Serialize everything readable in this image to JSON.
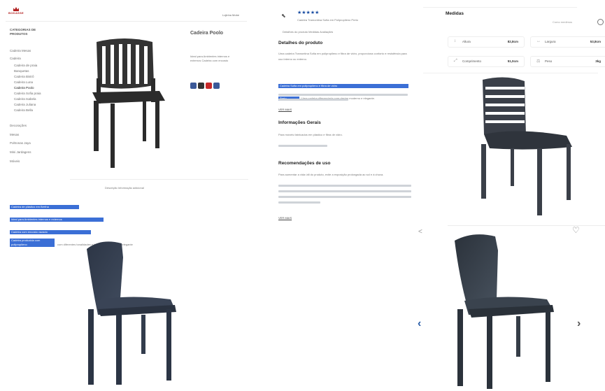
{
  "store": {
    "logo_text": "BOKASSE"
  },
  "left_panel": {
    "top_link": "Lojinha Mobe",
    "sidebar_title": "CATEGORIAS DE PRODUTOS",
    "sidebar_items": [
      "Cadeira Mesas",
      "Cadeira",
      "Cadeira de praia",
      "Banquetas",
      "Cadeira Bistrô",
      "Cadeira Luna",
      "Cadeira Poolo",
      "Cadeira Sofia praia",
      "Cadeira Isabela",
      "Cadeira Juliana",
      "Cadeira Bella",
      "Decorações",
      "Mesas",
      "Poltronas Jaya",
      "Mini Jardagens",
      "Móveis"
    ],
    "product_title": "Cadeira Poolo",
    "short_desc": "Ideal para Ambientes internos e externos Cadeira com encosto",
    "thumb_caption": "Descrição   Informação adicional",
    "highlighted_lines": [
      "Cadeira de plástico em Bertha",
      "Ideal para Ambientes internos e externos",
      "Cadeira com encosto vazado",
      "Cadeira produzida com polipropileno"
    ],
    "highlight_tail": "com diferentes tonalidades e linhas de acabamento elegante"
  },
  "middle_panel": {
    "stars": "★★★★★",
    "breadcrumb": "Cadeira Tramontina Sofia em Polipropileno Preto",
    "tabs": "Detalhes do produto   Medidas   Avaliações",
    "section_details": "Detalhes do produto",
    "details_text": "Uma cadeira Tramontina Sofia em polipropileno e fibra de vidro, proporciona conforto e resistência para uso interno ou externo.",
    "details_highlight_1": "Cadeira Sofia em polipropileno e fibra de vidro",
    "details_highlight_2": "Preto",
    "details_tail": "Uma cadeira diferenciada com design moderno e elegante.",
    "ver_mais_1": "VER MAIS",
    "section_info": "Informações Gerais",
    "info_text": "Para móveis fabricados em plástico e fibra de vidro.",
    "section_recs": "Recomendações de uso",
    "recs_text": "Para aumentar a vida útil do produto, evite a exposição prolongada ao sol e à chuva.",
    "ver_mais_2": "VER MAIS"
  },
  "right_panel": {
    "title": "Medidas",
    "search_placeholder": "Como medimos",
    "measures": [
      {
        "icon": "↕",
        "label": "Altura",
        "value": "82,8cm"
      },
      {
        "icon": "↔",
        "label": "Largura",
        "value": "53,8cm"
      },
      {
        "icon": "⤢",
        "label": "Comprimento",
        "value": "51,0cm"
      },
      {
        "icon": "⚖",
        "label": "Peso",
        "value": "3kg"
      }
    ]
  },
  "gallery": {
    "prev_arrow": "‹",
    "next_arrow": "›",
    "share_icon": "<",
    "heart_icon": "♡"
  }
}
